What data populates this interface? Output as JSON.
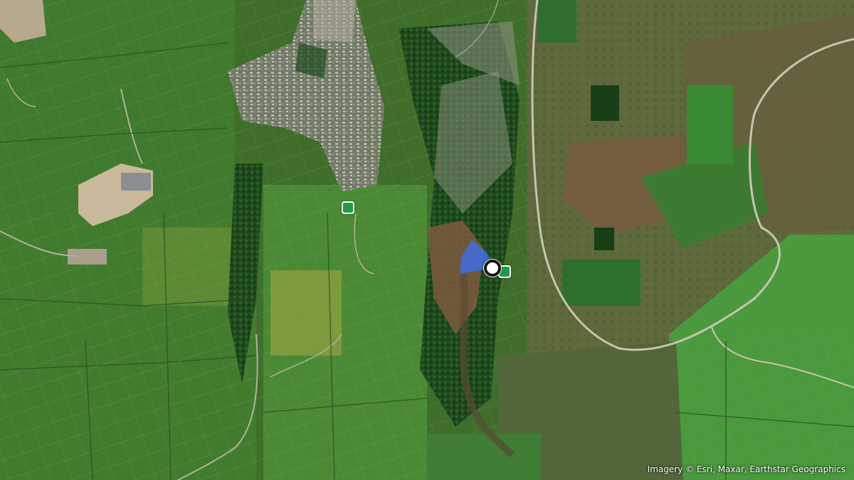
{
  "map": {
    "basemap": "satellite imagery",
    "attribution": "Imagery © Esri, Maxar, Earthstar Geographics",
    "current_location_icon": "location-dot-icon",
    "heading_cone_color": "#3d6fe0",
    "marker_color": "#1e9b4d",
    "markers": [
      {
        "icon": "green-square-marker-icon"
      },
      {
        "icon": "green-square-marker-icon"
      }
    ]
  }
}
